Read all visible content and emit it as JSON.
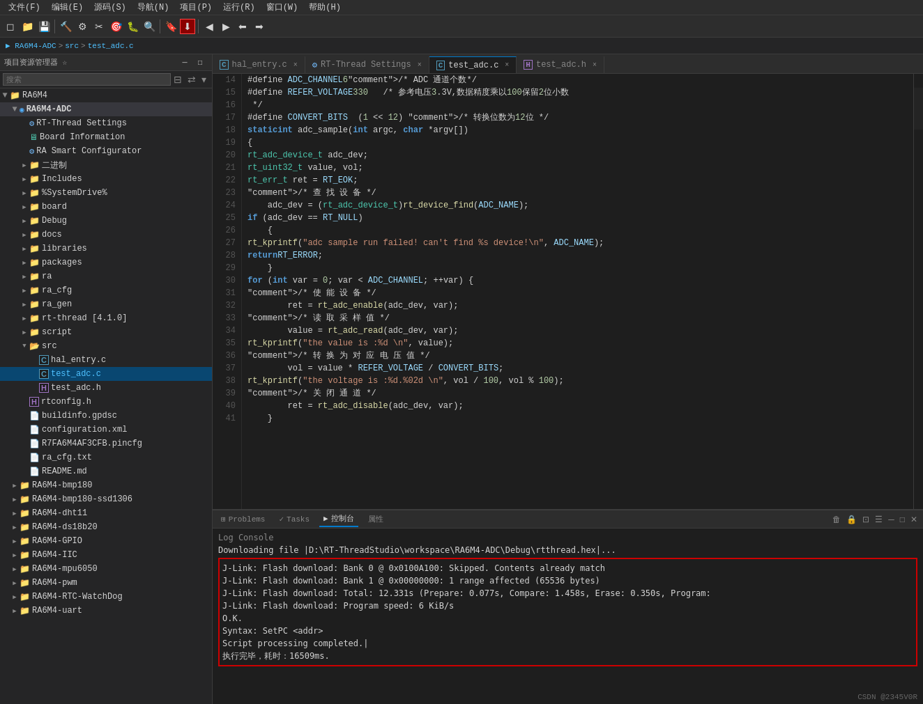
{
  "menubar": {
    "items": [
      "文件(F)",
      "编辑(E)",
      "源码(S)",
      "导航(N)",
      "项目(P)",
      "运行(R)",
      "窗口(W)",
      "帮助(H)"
    ]
  },
  "breadcrumb": {
    "parts": [
      "RA6M4-ADC",
      "src",
      "test_adc.c"
    ]
  },
  "sidebar": {
    "title": "项目资源管理器 ☆",
    "search_placeholder": "搜索",
    "root": "RA6M4",
    "active_project": "RA6M4-ADC",
    "items": [
      {
        "label": "RT-Thread Settings",
        "type": "settings",
        "indent": 1,
        "expandable": false
      },
      {
        "label": "Board Information",
        "type": "board",
        "indent": 1,
        "expandable": false
      },
      {
        "label": "RA Smart Configurator",
        "type": "settings",
        "indent": 1,
        "expandable": false
      },
      {
        "label": "二进制",
        "type": "folder",
        "indent": 1,
        "expandable": true
      },
      {
        "label": "Includes",
        "type": "folder",
        "indent": 1,
        "expandable": true
      },
      {
        "label": "%SystemDrive%",
        "type": "folder",
        "indent": 1,
        "expandable": true
      },
      {
        "label": "board",
        "type": "folder",
        "indent": 1,
        "expandable": true
      },
      {
        "label": "Debug",
        "type": "folder",
        "indent": 1,
        "expandable": true
      },
      {
        "label": "docs",
        "type": "folder",
        "indent": 1,
        "expandable": true
      },
      {
        "label": "libraries",
        "type": "folder",
        "indent": 1,
        "expandable": true
      },
      {
        "label": "packages",
        "type": "folder",
        "indent": 1,
        "expandable": true
      },
      {
        "label": "ra",
        "type": "folder",
        "indent": 1,
        "expandable": true
      },
      {
        "label": "ra_cfg",
        "type": "folder",
        "indent": 1,
        "expandable": true
      },
      {
        "label": "ra_gen",
        "type": "folder",
        "indent": 1,
        "expandable": true
      },
      {
        "label": "rt-thread [4.1.0]",
        "type": "folder",
        "indent": 1,
        "expandable": true
      },
      {
        "label": "script",
        "type": "folder",
        "indent": 1,
        "expandable": true
      },
      {
        "label": "src",
        "type": "folder-open",
        "indent": 1,
        "expandable": true,
        "expanded": true
      },
      {
        "label": "hal_entry.c",
        "type": "c-file",
        "indent": 2,
        "expandable": false
      },
      {
        "label": "test_adc.c",
        "type": "c-file",
        "indent": 2,
        "expandable": false,
        "active": true
      },
      {
        "label": "test_adc.h",
        "type": "h-file",
        "indent": 2,
        "expandable": false
      },
      {
        "label": "rtconfig.h",
        "type": "h-file",
        "indent": 1,
        "expandable": false
      },
      {
        "label": "buildinfo.gpdsc",
        "type": "txt",
        "indent": 1,
        "expandable": false
      },
      {
        "label": "configuration.xml",
        "type": "txt",
        "indent": 1,
        "expandable": false
      },
      {
        "label": "R7FA6M4AF3CFB.pincfg",
        "type": "txt",
        "indent": 1,
        "expandable": false
      },
      {
        "label": "ra_cfg.txt",
        "type": "txt",
        "indent": 1,
        "expandable": false
      },
      {
        "label": "README.md",
        "type": "txt",
        "indent": 1,
        "expandable": false
      },
      {
        "label": "RA6M4-bmp180",
        "type": "folder",
        "indent": 0,
        "expandable": true
      },
      {
        "label": "RA6M4-bmp180-ssd1306",
        "type": "folder",
        "indent": 0,
        "expandable": true
      },
      {
        "label": "RA6M4-dht11",
        "type": "folder",
        "indent": 0,
        "expandable": true
      },
      {
        "label": "RA6M4-ds18b20",
        "type": "folder",
        "indent": 0,
        "expandable": true
      },
      {
        "label": "RA6M4-GPIO",
        "type": "folder",
        "indent": 0,
        "expandable": true
      },
      {
        "label": "RA6M4-IIC",
        "type": "folder",
        "indent": 0,
        "expandable": true
      },
      {
        "label": "RA6M4-mpu6050",
        "type": "folder",
        "indent": 0,
        "expandable": true
      },
      {
        "label": "RA6M4-pwm",
        "type": "folder",
        "indent": 0,
        "expandable": true
      },
      {
        "label": "RA6M4-RTC-WatchDog",
        "type": "folder",
        "indent": 0,
        "expandable": true
      },
      {
        "label": "RA6M4-uart",
        "type": "folder",
        "indent": 0,
        "expandable": true
      }
    ]
  },
  "tabs": [
    {
      "label": "hal_entry.c",
      "type": "c",
      "active": false,
      "modified": false
    },
    {
      "label": "RT-Thread Settings",
      "type": "settings",
      "active": false,
      "modified": false
    },
    {
      "label": "test_adc.c",
      "type": "c",
      "active": true,
      "modified": false
    },
    {
      "label": "test_adc.h",
      "type": "h",
      "active": false,
      "modified": false
    }
  ],
  "code": {
    "lines": [
      {
        "n": 14,
        "text": "#define ADC_CHANNEL        6     /* ADC 通道个数*/"
      },
      {
        "n": 15,
        "text": "#define REFER_VOLTAGE      330   /* 参考电压3.3V,数据精度乘以100保留2位小数"
      },
      {
        "n": 16,
        "text": " */"
      },
      {
        "n": 17,
        "text": "#define CONVERT_BITS  (1 << 12) /* 转换位数为12位 */"
      },
      {
        "n": 18,
        "text": "static int adc_sample(int argc, char *argv[])"
      },
      {
        "n": 19,
        "text": "{"
      },
      {
        "n": 20,
        "text": "    rt_adc_device_t adc_dev;"
      },
      {
        "n": 21,
        "text": "    rt_uint32_t value, vol;"
      },
      {
        "n": 22,
        "text": "    rt_err_t ret = RT_EOK;"
      },
      {
        "n": 23,
        "text": "    /* 查 找 设 备 */"
      },
      {
        "n": 24,
        "text": "    adc_dev = (rt_adc_device_t)rt_device_find(ADC_NAME);"
      },
      {
        "n": 25,
        "text": "    if (adc_dev == RT_NULL)"
      },
      {
        "n": 26,
        "text": "    {"
      },
      {
        "n": 27,
        "text": "        rt_kprintf(\"adc sample run failed! can't find %s device!\\n\", ADC_NAME);"
      },
      {
        "n": 28,
        "text": "        return RT_ERROR;"
      },
      {
        "n": 29,
        "text": "    }"
      },
      {
        "n": 30,
        "text": "    for (int var = 0; var < ADC_CHANNEL; ++var) {"
      },
      {
        "n": 31,
        "text": "        /* 使 能 设 备 */"
      },
      {
        "n": 32,
        "text": "        ret = rt_adc_enable(adc_dev, var);"
      },
      {
        "n": 33,
        "text": "        /* 读 取 采 样 值 */"
      },
      {
        "n": 34,
        "text": "        value = rt_adc_read(adc_dev, var);"
      },
      {
        "n": 35,
        "text": "        rt_kprintf(\"the value is :%d \\n\", value);"
      },
      {
        "n": 36,
        "text": "        /* 转 换 为 对 应 电 压 值 */"
      },
      {
        "n": 37,
        "text": "        vol = value * REFER_VOLTAGE / CONVERT_BITS;"
      },
      {
        "n": 38,
        "text": "        rt_kprintf(\"the voltage is :%d.%02d \\n\", vol / 100, vol % 100);"
      },
      {
        "n": 39,
        "text": "        /* 关 闭 通 道 */"
      },
      {
        "n": 40,
        "text": "        ret = rt_adc_disable(adc_dev, var);"
      },
      {
        "n": 41,
        "text": "    }"
      }
    ]
  },
  "panel": {
    "tabs": [
      "Problems",
      "Tasks",
      "控制台",
      "属性"
    ],
    "active_tab": "控制台",
    "log_label": "Log Console",
    "console_lines": [
      "Downloading file |D:\\RT-ThreadStudio\\workspace\\RA6M4-ADC\\Debug\\rtthread.hex|...",
      "J-Link: Flash download: Bank 0 @ 0x0100A100: Skipped. Contents already match",
      "J-Link: Flash download: Bank 1 @ 0x00000000: 1 range affected (65536 bytes)",
      "J-Link: Flash download: Total: 12.331s (Prepare: 0.077s, Compare: 1.458s, Erase: 0.350s, Program:",
      "J-Link: Flash download: Program speed: 6 KiB/s",
      "O.K.",
      "Syntax: SetPC <addr>",
      "Script processing completed.|",
      "执行完毕，耗时：16509ms."
    ]
  },
  "watermark": "CSDN @2345V0R"
}
